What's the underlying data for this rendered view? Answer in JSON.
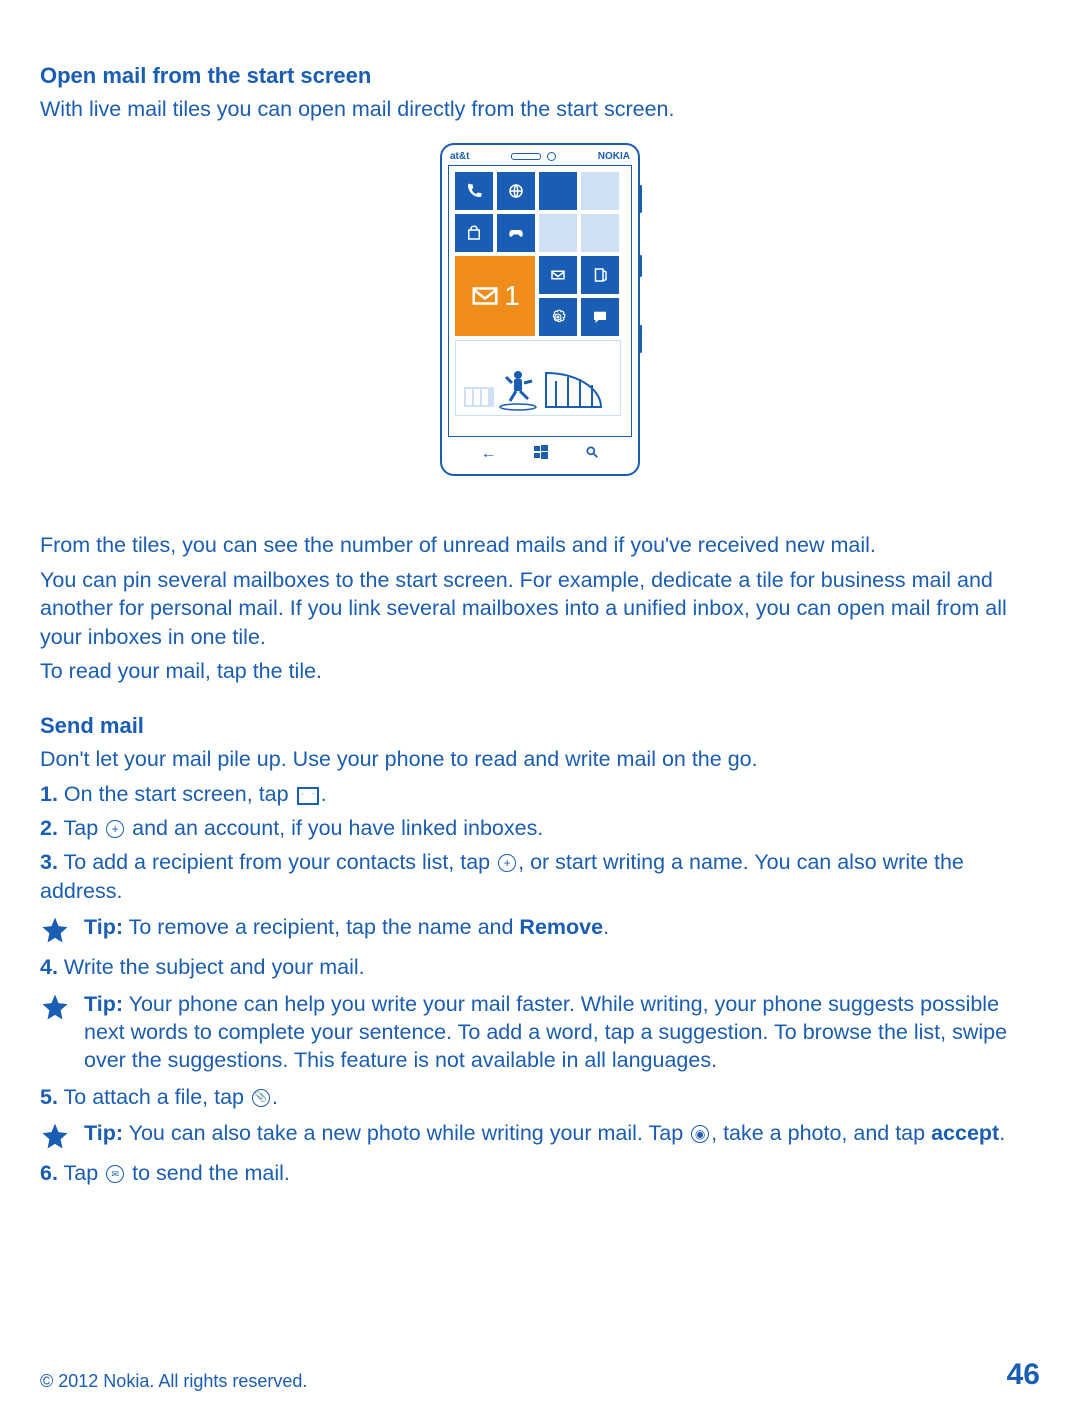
{
  "section1": {
    "heading": "Open mail from the start screen",
    "intro": "With live mail tiles you can open mail directly from the start screen.",
    "para1": "From the tiles, you can see the number of unread mails and if you've received new mail.",
    "para2": "You can pin several mailboxes to the start screen. For example, dedicate a tile for business mail and another for personal mail. If you link several mailboxes into a unified inbox, you can open mail from all your inboxes in one tile.",
    "para3": "To read your mail, tap the tile."
  },
  "section2": {
    "heading": "Send mail",
    "intro": "Don't let your mail pile up. Use your phone to read and write mail on the go.",
    "step1": {
      "num": "1.",
      "a": " On the start screen, tap ",
      "b": "."
    },
    "step2": {
      "num": "2.",
      "a": " Tap ",
      "b": " and an account, if you have linked inboxes."
    },
    "step3": {
      "num": "3.",
      "a": " To add a recipient from your contacts list, tap ",
      "b": ", or start writing a name. You can also write the address."
    },
    "tip1": {
      "label": "Tip:",
      "a": " To remove a recipient, tap the name and ",
      "b": "Remove",
      "c": "."
    },
    "step4": {
      "num": "4.",
      "text": " Write the subject and your mail."
    },
    "tip2": {
      "label": "Tip:",
      "text": " Your phone can help you write your mail faster. While writing, your phone suggests possible next words to complete your sentence. To add a word, tap a suggestion. To browse the list, swipe over the suggestions. This feature is not available in all languages."
    },
    "step5": {
      "num": "5.",
      "a": " To attach a file, tap ",
      "b": "."
    },
    "tip3": {
      "label": "Tip:",
      "a": " You can also take a new photo while writing your mail. Tap ",
      "b": ", take a photo, and tap ",
      "c": "accept",
      "d": "."
    },
    "step6": {
      "num": "6.",
      "a": " Tap ",
      "b": " to send the mail."
    }
  },
  "phone": {
    "carrier": "at&t",
    "brand": "NOKIA",
    "mail_count": "1"
  },
  "footer": {
    "copyright": "© 2012 Nokia. All rights reserved.",
    "page": "46"
  }
}
